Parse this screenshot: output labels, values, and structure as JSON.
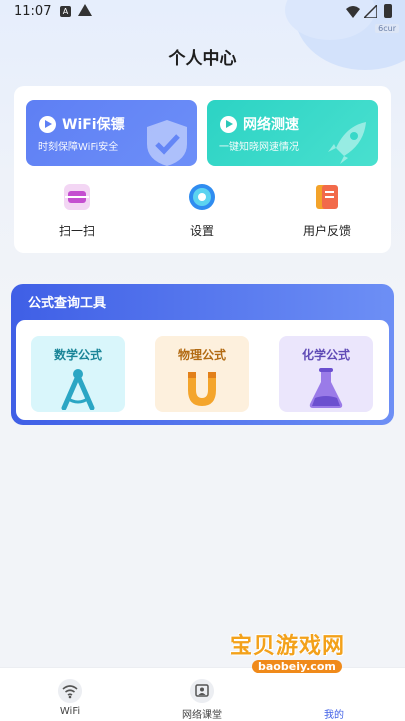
{
  "status_bar": {
    "time": "11:07"
  },
  "corner_badge": "6cur",
  "header": {
    "title": "个人中心"
  },
  "promos": [
    {
      "title": "WiFi保镖",
      "subtitle": "时刻保障WiFi安全",
      "icon": "shield-check-icon",
      "color": "#5e7ff4"
    },
    {
      "title": "网络测速",
      "subtitle": "一键知晓网速情况",
      "icon": "rocket-icon",
      "color": "#2cd3c4"
    }
  ],
  "quick_actions": [
    {
      "label": "扫一扫",
      "icon": "scan-icon"
    },
    {
      "label": "设置",
      "icon": "gear-icon"
    },
    {
      "label": "用户反馈",
      "icon": "feedback-icon"
    }
  ],
  "formula_tools": {
    "title": "公式查询工具",
    "items": [
      {
        "label": "数学公式",
        "icon": "compass-icon"
      },
      {
        "label": "物理公式",
        "icon": "magnet-icon"
      },
      {
        "label": "化学公式",
        "icon": "flask-icon"
      }
    ]
  },
  "bottom_nav": [
    {
      "label": "WiFi",
      "icon": "wifi-icon"
    },
    {
      "label": "网络课堂",
      "icon": "classroom-icon"
    },
    {
      "label": "我的",
      "icon": "profile-icon",
      "active": true
    }
  ],
  "watermark": {
    "title": "宝贝游戏网",
    "url": "baobeiy.com"
  }
}
